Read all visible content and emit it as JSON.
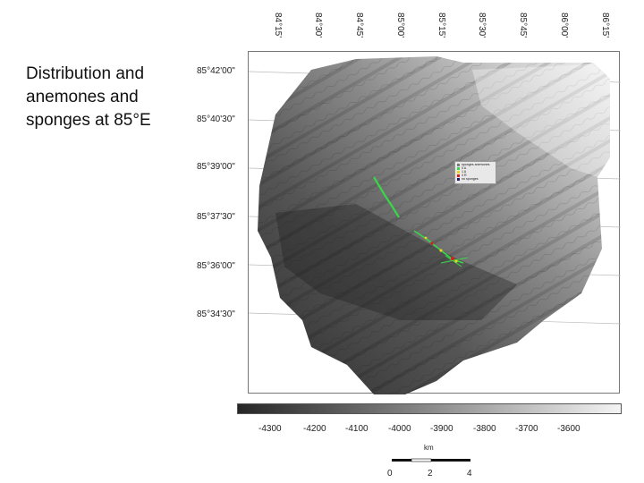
{
  "slide": {
    "title_lines": [
      "Distribution and",
      "anemones and",
      "sponges at 85°E"
    ]
  },
  "map": {
    "longitude_labels": [
      "84°15'",
      "84°30'",
      "84°45'",
      "85°00'",
      "85°15'",
      "85°30'",
      "85°45'",
      "86°00'",
      "86°15'"
    ],
    "latitude_labels": [
      "85°42'00\"",
      "85°40'30\"",
      "85°39'00\"",
      "85°37'30\"",
      "85°36'00\"",
      "85°34'30\""
    ],
    "colors": {
      "deep": "#2e2e2e",
      "shallow": "#f2f2f2",
      "green_marker": "#39d64a",
      "yellow_marker": "#e8d21a",
      "red_marker": "#d42020"
    }
  },
  "legend": {
    "entries": [
      {
        "label": "sponges  anemones",
        "color": "#7a7a7a"
      },
      {
        "label": "0  A",
        "color": "#39d64a"
      },
      {
        "label": "1  A",
        "color": "#e8d21a"
      },
      {
        "label": "4  R",
        "color": "#d42020"
      },
      {
        "label": "no sponges",
        "color": "#202060"
      }
    ]
  },
  "depth_scale": {
    "ticks": [
      "-4300",
      "-4200",
      "-4100",
      "-4000",
      "-3900",
      "-3800",
      "-3700",
      "-3600"
    ]
  },
  "distance_scale": {
    "unit": "km",
    "ticks": [
      "0",
      "2",
      "4"
    ]
  }
}
